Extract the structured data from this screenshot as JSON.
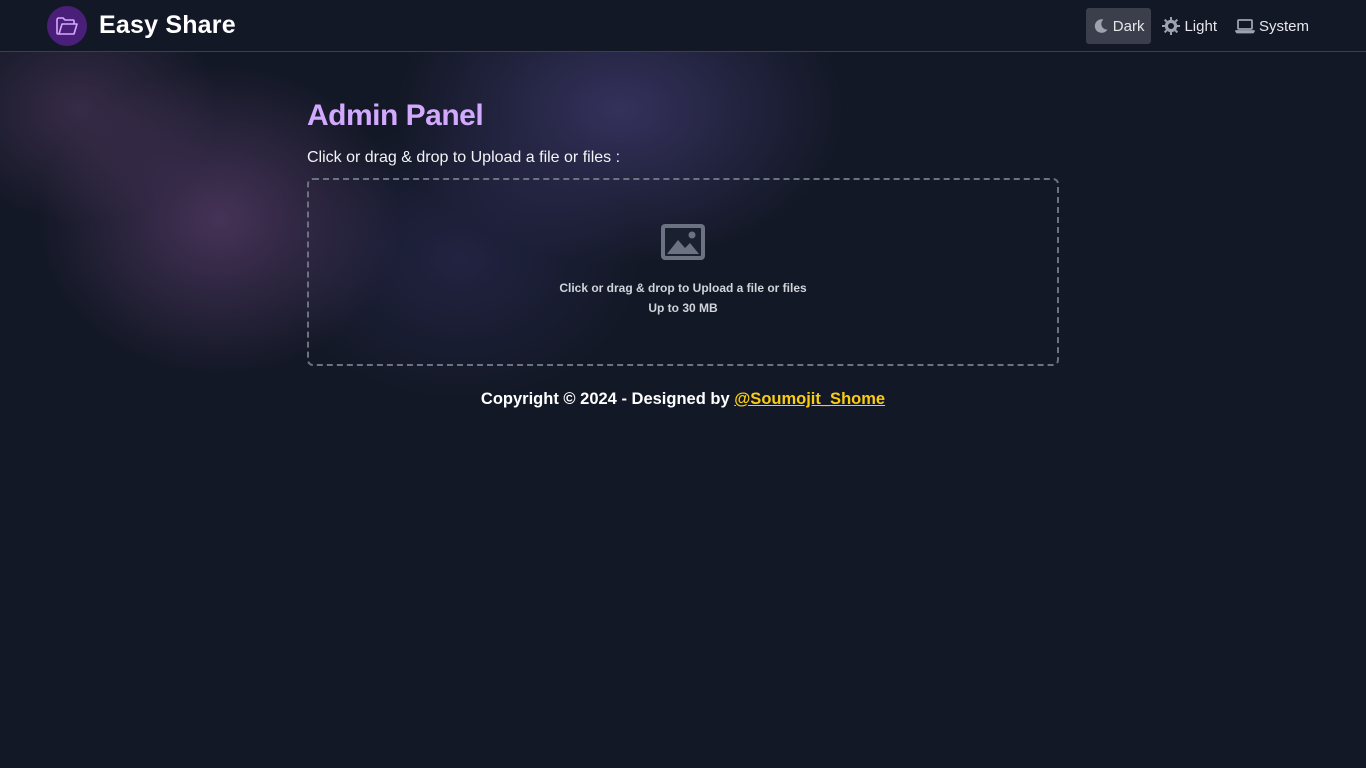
{
  "app": {
    "name": "Easy Share",
    "logo_icon": "folder-icon"
  },
  "theme_switcher": {
    "options": [
      {
        "label": "Dark",
        "icon": "moon-icon",
        "active": true
      },
      {
        "label": "Light",
        "icon": "sun-icon",
        "active": false
      },
      {
        "label": "System",
        "icon": "laptop-icon",
        "active": false
      }
    ]
  },
  "main": {
    "title": "Admin Panel",
    "upload_label": "Click or drag & drop to Upload a file or files :",
    "dropzone": {
      "icon": "image-icon",
      "primary_text": "Click or drag & drop to Upload a file or files",
      "secondary_text": "Up to 30 MB"
    }
  },
  "footer": {
    "text": "Copyright © 2024 - Designed by ",
    "author_link": "@Soumojit_Shome"
  },
  "colors": {
    "background": "#131826",
    "title": "#d2a9ff",
    "link": "#facc15",
    "logo_bg": "#4a1f7a"
  }
}
